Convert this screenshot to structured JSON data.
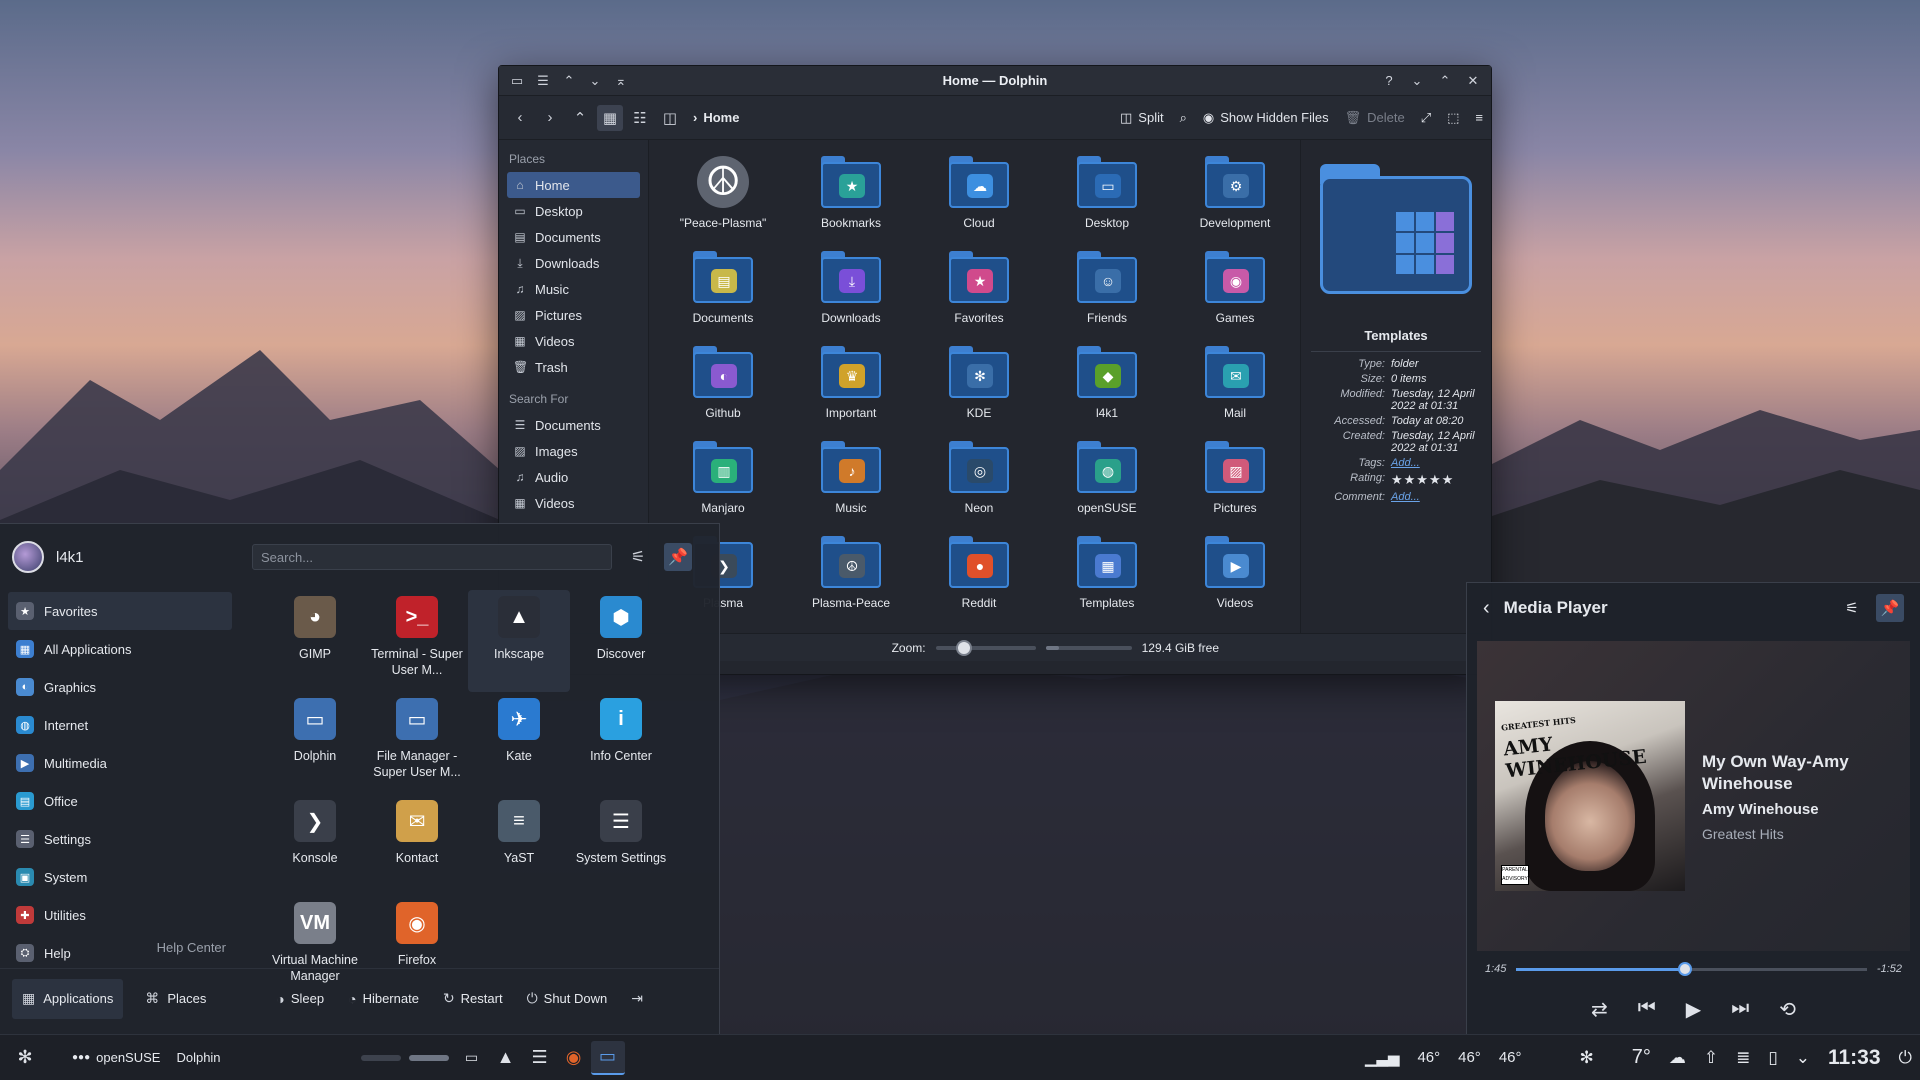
{
  "dolphin": {
    "title": "Home — Dolphin",
    "breadcrumb": "Home",
    "toolbar": {
      "split": "Split",
      "show_hidden": "Show Hidden Files",
      "delete": "Delete"
    },
    "places_heading": "Places",
    "places": [
      {
        "label": "Home",
        "icon": "home-icon",
        "glyph": "⌂"
      },
      {
        "label": "Desktop",
        "icon": "desktop-icon",
        "glyph": "▭"
      },
      {
        "label": "Documents",
        "icon": "documents-icon",
        "glyph": "▤"
      },
      {
        "label": "Downloads",
        "icon": "downloads-icon",
        "glyph": "⤓"
      },
      {
        "label": "Music",
        "icon": "music-icon",
        "glyph": "♫"
      },
      {
        "label": "Pictures",
        "icon": "pictures-icon",
        "glyph": "▨"
      },
      {
        "label": "Videos",
        "icon": "videos-icon",
        "glyph": "▦"
      },
      {
        "label": "Trash",
        "icon": "trash-icon",
        "glyph": "🗑"
      }
    ],
    "search_heading": "Search For",
    "search_for": [
      {
        "label": "Documents",
        "icon": "documents-icon",
        "glyph": "☰"
      },
      {
        "label": "Images",
        "icon": "images-icon",
        "glyph": "▨"
      },
      {
        "label": "Audio",
        "icon": "audio-icon",
        "glyph": "♫"
      },
      {
        "label": "Videos",
        "icon": "videos-icon",
        "glyph": "▦"
      }
    ],
    "files": [
      {
        "name": "\"Peace-Plasma\"",
        "glyph": "☮",
        "color": "#5e6470"
      },
      {
        "name": "Bookmarks",
        "glyph": "★",
        "color": "#2aa198"
      },
      {
        "name": "Cloud",
        "glyph": "☁",
        "color": "#3d8fe0"
      },
      {
        "name": "Desktop",
        "glyph": "▭",
        "color": "#2b6bb5"
      },
      {
        "name": "Development",
        "glyph": "⚙",
        "color": "#3a6ea8"
      },
      {
        "name": "Documents",
        "glyph": "▤",
        "color": "#c8b84a"
      },
      {
        "name": "Downloads",
        "glyph": "⤓",
        "color": "#7a4fd8"
      },
      {
        "name": "Favorites",
        "glyph": "★",
        "color": "#d04a8c"
      },
      {
        "name": "Friends",
        "glyph": "☺",
        "color": "#3a6ea8"
      },
      {
        "name": "Games",
        "glyph": "◉",
        "color": "#c85aa8"
      },
      {
        "name": "Github",
        "glyph": "◐",
        "color": "#8a5ad0"
      },
      {
        "name": "Important",
        "glyph": "♛",
        "color": "#d0a22a"
      },
      {
        "name": "KDE",
        "glyph": "✻",
        "color": "#3a6ea8"
      },
      {
        "name": "l4k1",
        "glyph": "◆",
        "color": "#5aa02a"
      },
      {
        "name": "Mail",
        "glyph": "✉",
        "color": "#2aa0b0"
      },
      {
        "name": "Manjaro",
        "glyph": "▥",
        "color": "#2ab07a"
      },
      {
        "name": "Music",
        "glyph": "♪",
        "color": "#d07a2a"
      },
      {
        "name": "Neon",
        "glyph": "◎",
        "color": "#2a4a6a"
      },
      {
        "name": "openSUSE",
        "glyph": "◍",
        "color": "#2aa08a"
      },
      {
        "name": "Pictures",
        "glyph": "▨",
        "color": "#d05a7a"
      },
      {
        "name": "Plasma",
        "glyph": "❯",
        "color": "#3a4a5a"
      },
      {
        "name": "Plasma-Peace",
        "glyph": "☮",
        "color": "#4a5a6a"
      },
      {
        "name": "Reddit",
        "glyph": "●",
        "color": "#e0502a"
      },
      {
        "name": "Templates",
        "glyph": "▦",
        "color": "#4a7ad0"
      },
      {
        "name": "Videos",
        "glyph": "▶",
        "color": "#4a8ad0"
      }
    ],
    "info": {
      "title": "Templates",
      "rows": [
        {
          "k": "Type:",
          "v": "folder"
        },
        {
          "k": "Size:",
          "v": "0 items"
        },
        {
          "k": "Modified:",
          "v": "Tuesday, 12 April 2022 at 01:31"
        },
        {
          "k": "Accessed:",
          "v": "Today at 08:20"
        },
        {
          "k": "Created:",
          "v": "Tuesday, 12 April 2022 at 01:31"
        }
      ],
      "tags_label": "Tags:",
      "tags_value": "Add...",
      "rating_label": "Rating:",
      "rating_stars": "★★★★★",
      "comment_label": "Comment:",
      "comment_value": "Add..."
    },
    "status": {
      "zoom_label": "Zoom:",
      "free_space": "129.4 GiB free"
    }
  },
  "launcher": {
    "username": "l4k1",
    "search_placeholder": "Search...",
    "categories": [
      {
        "label": "Favorites",
        "color": "#5a6070",
        "glyph": "★"
      },
      {
        "label": "All Applications",
        "color": "#3d7fd0",
        "glyph": "▦"
      },
      {
        "label": "Graphics",
        "color": "#4a8ad0",
        "glyph": "◐"
      },
      {
        "label": "Internet",
        "color": "#2a8ad0",
        "glyph": "◍"
      },
      {
        "label": "Multimedia",
        "color": "#3d6fb0",
        "glyph": "▶"
      },
      {
        "label": "Office",
        "color": "#2a9ad0",
        "glyph": "▤"
      },
      {
        "label": "Settings",
        "color": "#5a6070",
        "glyph": "☰"
      },
      {
        "label": "System",
        "color": "#2a8ab0",
        "glyph": "▣"
      },
      {
        "label": "Utilities",
        "color": "#c03a3a",
        "glyph": "✚"
      },
      {
        "label": "Help",
        "color": "#5a6070",
        "glyph": "⛭"
      }
    ],
    "help_center": "Help Center",
    "apps": [
      {
        "name": "GIMP",
        "glyph": "◕",
        "color": "#6a5a4a",
        "icon": "gimp-icon"
      },
      {
        "name": "Terminal - Super User M...",
        "glyph": ">_",
        "color": "#c0222a",
        "icon": "terminal-icon"
      },
      {
        "name": "Inkscape",
        "glyph": "▲",
        "color": "#2a2e38",
        "icon": "inkscape-icon"
      },
      {
        "name": "Discover",
        "glyph": "⬢",
        "color": "#2a8ad0",
        "icon": "discover-icon"
      },
      {
        "name": "Dolphin",
        "glyph": "▭",
        "color": "#3d6fb0",
        "icon": "dolphin-icon"
      },
      {
        "name": "File Manager - Super User M...",
        "glyph": "▭",
        "color": "#3d6fb0",
        "icon": "file-manager-icon"
      },
      {
        "name": "Kate",
        "glyph": "✈",
        "color": "#2a7ad0",
        "icon": "kate-icon"
      },
      {
        "name": "Info Center",
        "glyph": "i",
        "color": "#2aa0e0",
        "icon": "info-center-icon"
      },
      {
        "name": "Konsole",
        "glyph": "❯",
        "color": "#3a3f4a",
        "icon": "konsole-icon"
      },
      {
        "name": "Kontact",
        "glyph": "✉",
        "color": "#d0a04a",
        "icon": "kontact-icon"
      },
      {
        "name": "YaST",
        "glyph": "≡",
        "color": "#4a5a6a",
        "icon": "yast-icon"
      },
      {
        "name": "System Settings",
        "glyph": "☰",
        "color": "#3a3f4a",
        "icon": "system-settings-icon"
      },
      {
        "name": "Virtual Machine Manager",
        "glyph": "VM",
        "color": "#7a7f8a",
        "icon": "virt-manager-icon"
      },
      {
        "name": "Firefox",
        "glyph": "◉",
        "color": "#e0642a",
        "icon": "firefox-icon"
      }
    ],
    "footer": {
      "applications": "Applications",
      "places": "Places",
      "sleep": "Sleep",
      "hibernate": "Hibernate",
      "restart": "Restart",
      "shutdown": "Shut Down"
    }
  },
  "media": {
    "header": "Media Player",
    "song": "My Own Way-Amy Winehouse",
    "artist": "Amy Winehouse",
    "album": "Greatest Hits",
    "cover_text": "AMY WINEHOUSE",
    "cover_sub": "GREATEST HITS",
    "elapsed": "1:45",
    "remaining": "-1:52",
    "progress": 0.48
  },
  "taskbar": {
    "distro": "openSUSE",
    "active_app": "Dolphin",
    "temps": [
      "46°",
      "46°",
      "46°"
    ],
    "weather_temp": "7°",
    "clock": "11:33"
  }
}
